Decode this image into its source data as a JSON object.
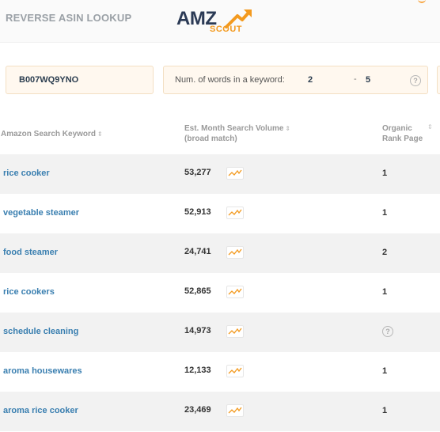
{
  "header": {
    "title": "REVERSE ASIN LOOKUP",
    "logo": {
      "main": "AMZ",
      "sub": "SCOUT",
      "icon": "arrow-up-icon"
    }
  },
  "filters": {
    "asin_value": "B007WQ9YNO",
    "words_label": "Num. of words in a keyword:",
    "words_min": "2",
    "words_dash": "-",
    "words_max": "5"
  },
  "table": {
    "columns": {
      "keyword": "Amazon Search Keyword",
      "volume_line1": "Est. Month Search Volume",
      "volume_line2": "(broad match)",
      "rank_line1": "Organic",
      "rank_line2": "Rank Page"
    },
    "rows": [
      {
        "keyword": "rice cooker",
        "volume": "53,277",
        "rank": "1"
      },
      {
        "keyword": "vegetable steamer",
        "volume": "52,913",
        "rank": "1"
      },
      {
        "keyword": "food steamer",
        "volume": "24,741",
        "rank": "2"
      },
      {
        "keyword": "rice cookers",
        "volume": "52,865",
        "rank": "1"
      },
      {
        "keyword": "schedule cleaning",
        "volume": "14,973",
        "rank": "?"
      },
      {
        "keyword": "aroma housewares",
        "volume": "12,133",
        "rank": "1"
      },
      {
        "keyword": "aroma rice cooker",
        "volume": "23,469",
        "rank": "1"
      }
    ]
  },
  "colors": {
    "accent": "#f39a1f",
    "link": "#3a7fb0",
    "input_bg": "#fff8ef",
    "row_shade": "#f2f2f2"
  }
}
